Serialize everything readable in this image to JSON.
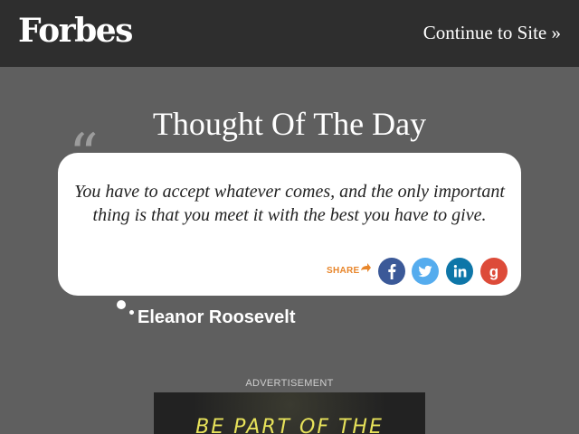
{
  "header": {
    "logo_text": "Forbes",
    "continue_link": "Continue to Site »"
  },
  "main": {
    "title": "Thought Of The Day",
    "quote": "You have to accept whatever comes, and the only important thing is that you meet it with the best you have to give.",
    "share_label": "SHARE",
    "social_icons": [
      "facebook-icon",
      "twitter-icon",
      "linkedin-icon",
      "google-plus-icon"
    ],
    "author": "Eleanor Roosevelt"
  },
  "ad": {
    "label": "ADVERTISEMENT",
    "visible_text": "BE PART OF THE"
  },
  "colors": {
    "topbar": "#2e2e2e",
    "background": "#5f5f5f",
    "share_orange": "#e8862b",
    "facebook": "#3b5998",
    "twitter": "#55acee",
    "linkedin": "#0e76a8",
    "google": "#dd4b39"
  }
}
